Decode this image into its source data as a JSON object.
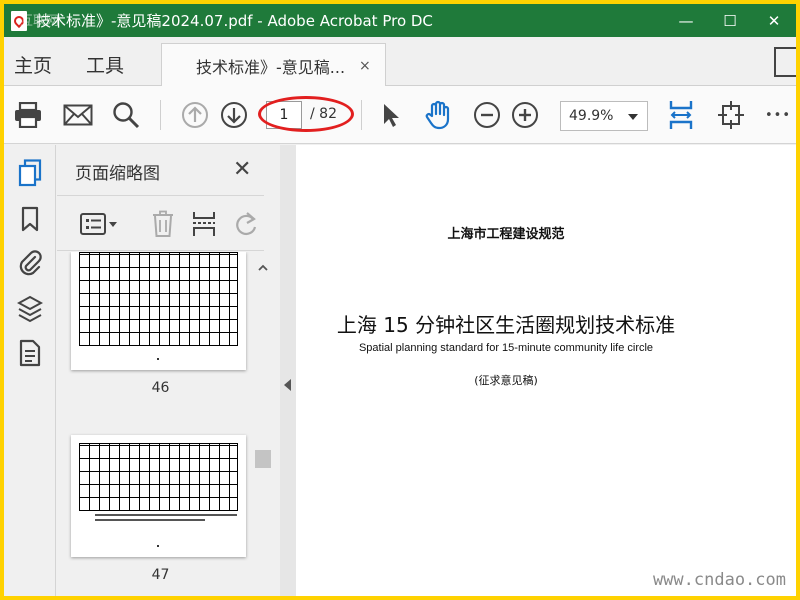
{
  "window": {
    "title": "技术标准》-意见稿2024.07.pdf - Adobe Acrobat Pro DC",
    "minimize": "—",
    "maximize": "☐",
    "close": "✕"
  },
  "nav": {
    "home": "主页",
    "tools": "工具"
  },
  "tab": {
    "label": "技术标准》-意见稿...",
    "close": "×"
  },
  "toolbar": {
    "current_page": "1",
    "total_pages": "/ 82",
    "zoom": "49.9%",
    "more": "•••"
  },
  "panel": {
    "title": "页面缩略图",
    "close": "✕",
    "thumbnails": [
      {
        "page": "46"
      },
      {
        "page": "47"
      }
    ]
  },
  "document": {
    "header": "上海市工程建设规范",
    "title": "上海 15 分钟社区生活圈规划技术标准",
    "subtitle": "Spatial planning standard for 15-minute community life circle",
    "note": "(征求意见稿)"
  },
  "watermark": {
    "text": "www.cndao.com",
    "corner": "互联网"
  },
  "colors": {
    "titlebar": "#1f7a3a",
    "frame": "#ffd200",
    "accent": "#1a73c9",
    "annotation": "#e21f1f"
  }
}
